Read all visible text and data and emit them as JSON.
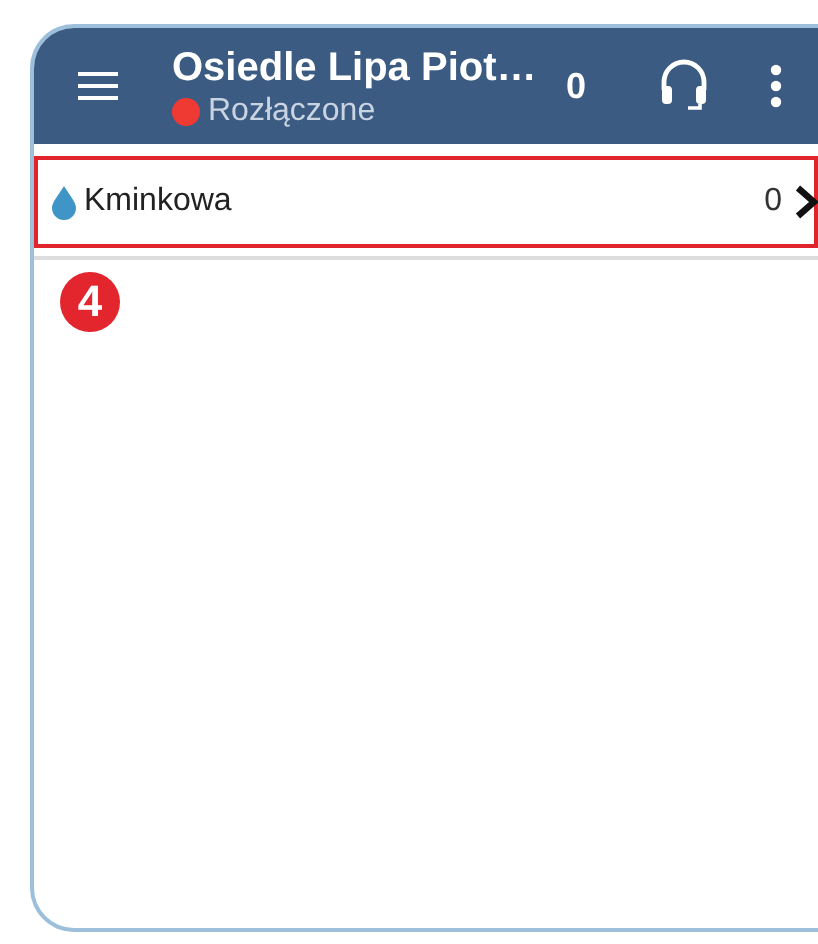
{
  "app_bar": {
    "title": "Osiedle Lipa Piot…",
    "status": {
      "text": "Rozłączone",
      "connected": false
    },
    "count": "0"
  },
  "list": [
    {
      "name": "Kminkowa",
      "count": "0",
      "highlighted": true
    }
  ],
  "callout": {
    "label": "4"
  }
}
